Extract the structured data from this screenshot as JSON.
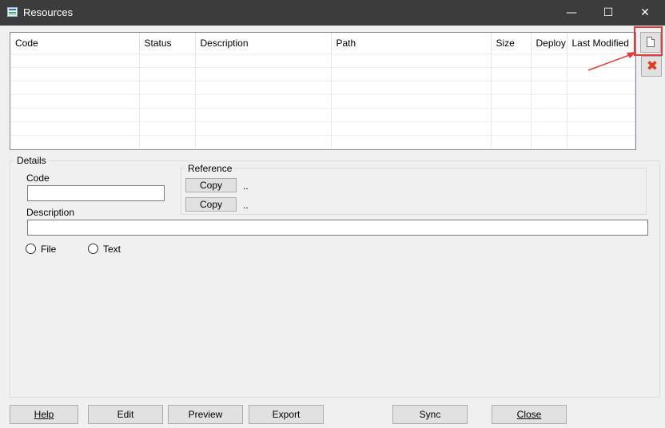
{
  "window": {
    "title": "Resources",
    "minimize_glyph": "—",
    "maximize_glyph": "☐",
    "close_glyph": "✕"
  },
  "grid": {
    "columns": [
      "Code",
      "Status",
      "Description",
      "Path",
      "Size",
      "Deploy",
      "Last Modified"
    ],
    "rows": []
  },
  "side_buttons": {
    "new_icon": "new-document-icon",
    "delete_icon": "delete-icon",
    "delete_glyph": "✖"
  },
  "details": {
    "legend": "Details",
    "code_label": "Code",
    "code_value": "",
    "description_label": "Description",
    "description_value": "",
    "reference": {
      "legend": "Reference",
      "copy1": "Copy",
      "copy2": "Copy",
      "value1": "..",
      "value2": ".."
    },
    "radio_file": "File",
    "radio_text": "Text"
  },
  "footer": {
    "help": "Help",
    "edit": "Edit",
    "preview": "Preview",
    "export": "Export",
    "sync": "Sync",
    "close": "Close"
  },
  "colors": {
    "titlebar": "#3c3c3c",
    "highlight": "#e33a3a",
    "delete": "#e03c1e"
  }
}
